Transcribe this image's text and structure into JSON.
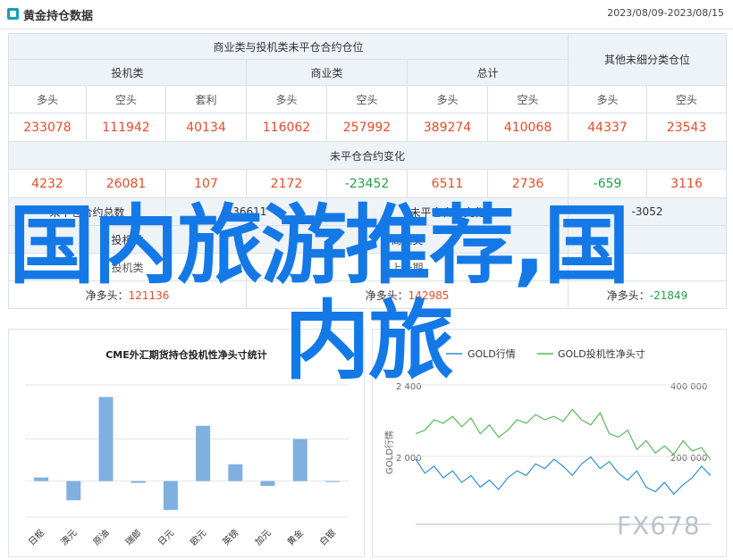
{
  "header": {
    "title": "黄金持仓数据",
    "date_range": "2023/08/09-2023/08/15"
  },
  "table": {
    "group_noncommercial": "商业类与投机类未平仓合约仓位",
    "group_other": "其他未细分类仓位",
    "sub_speculative": "投机类",
    "sub_commercial": "商业类",
    "sub_total": "总计",
    "cols": [
      "多头",
      "空头",
      "套利",
      "多头",
      "空头",
      "多头",
      "空头",
      "多头",
      "空头"
    ],
    "positions": [
      "233078",
      "111942",
      "40134",
      "116062",
      "257992",
      "389274",
      "410068",
      "44337",
      "23543"
    ],
    "change_title": "未平仓合约变化",
    "changes": [
      "4232",
      "26081",
      "107",
      "2172",
      "-23452",
      "6511",
      "2736",
      "-659",
      "3116"
    ],
    "total_label": "未平仓合约总数",
    "total_value": "436611",
    "total_change_label": "未平仓合约变化",
    "total_change_value": "-3052",
    "cat_label_1": "投机类",
    "cat_label_2": "商业类",
    "speculative_net_label": "净多头",
    "speculative_net_value": "121136",
    "commercial_net_label": "净多头",
    "commercial_net_value": "142985",
    "other_net_label": "净多头",
    "other_net_value": "-21849",
    "row4_a_label": "投机类",
    "row4_a_value": "",
    "row4_b_label": "商业类 新增",
    "row4_c_label": "上一期"
  },
  "chart1": {
    "title": "CME外汇期货持仓投机性净头寸统计",
    "chart_data": {
      "type": "bar",
      "title": "CME外汇期货持仓投机性净头寸统计",
      "categories": [
        "日枢",
        "澳元",
        "原油",
        "瑞郎",
        "日元",
        "欧元",
        "英镑",
        "加元",
        "黄金",
        "白银"
      ],
      "values": [
        0.3,
        -1.6,
        7.0,
        -0.15,
        -2.4,
        4.6,
        1.4,
        -0.4,
        3.5,
        0.0
      ],
      "ylim": [
        -3,
        8
      ],
      "grid": true
    }
  },
  "chart2": {
    "legend_gold": "GOLD行情",
    "legend_spec": "GOLD投机性净头寸",
    "y_left_ticks": [
      "2 400",
      "2 000"
    ],
    "y_right_ticks": [
      "400 000",
      "200 000"
    ],
    "y_left_label": "GOLD行情",
    "colors": {
      "gold": "#2f8fd0",
      "spec": "#5cb85c"
    },
    "chart_data": {
      "type": "line",
      "series": [
        {
          "name": "GOLD行情",
          "values": [
            2080,
            2020,
            2050,
            2000,
            2030,
            1980,
            2010,
            1960,
            1990,
            1950,
            2000,
            2030,
            2010,
            2060,
            2040,
            2080,
            2050,
            2010,
            2060,
            2090,
            2040,
            2070,
            2020,
            1990,
            2030,
            1960,
            1940,
            1980,
            1930,
            1970,
            2000,
            2050,
            2010
          ]
        },
        {
          "name": "GOLD投机性净头寸",
          "values": [
            260000,
            270000,
            300000,
            290000,
            310000,
            280000,
            305000,
            260000,
            285000,
            250000,
            270000,
            300000,
            290000,
            315000,
            300000,
            310000,
            295000,
            330000,
            300000,
            285000,
            320000,
            260000,
            250000,
            270000,
            215000,
            240000,
            205000,
            225000,
            200000,
            240000,
            210000,
            220000,
            185000
          ]
        }
      ],
      "ylim_left": [
        1800,
        2400
      ],
      "ylim_right": [
        0,
        400000
      ]
    }
  },
  "overlay": {
    "line1": "国内旅游推荐,国",
    "line2": "内旅"
  },
  "watermark": "FX678"
}
